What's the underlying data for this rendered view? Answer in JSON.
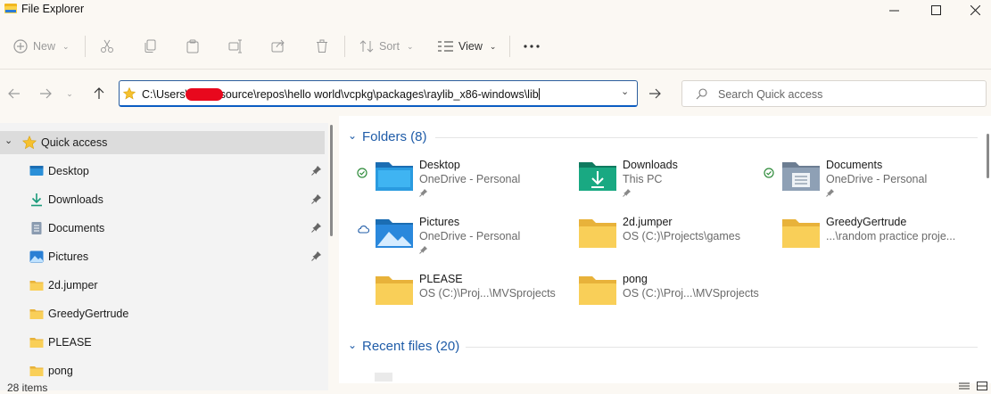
{
  "window": {
    "title": "File Explorer"
  },
  "toolbar": {
    "new_label": "New",
    "sort_label": "Sort",
    "view_label": "View"
  },
  "address": {
    "path_prefix": "C:\\Users\\",
    "path_suffix": "\\source\\repos\\hello world\\vcpkg\\packages\\raylib_x86-windows\\lib"
  },
  "search": {
    "placeholder": "Search Quick access"
  },
  "sidebar": {
    "items": [
      {
        "label": "Quick access",
        "icon": "star-icon"
      },
      {
        "label": "Desktop",
        "icon": "desktop-icon",
        "pinned": true
      },
      {
        "label": "Downloads",
        "icon": "download-icon",
        "pinned": true
      },
      {
        "label": "Documents",
        "icon": "document-icon",
        "pinned": true
      },
      {
        "label": "Pictures",
        "icon": "pictures-icon",
        "pinned": true
      },
      {
        "label": "2d.jumper",
        "icon": "folder-icon"
      },
      {
        "label": "GreedyGertrude",
        "icon": "folder-icon"
      },
      {
        "label": "PLEASE",
        "icon": "folder-icon"
      },
      {
        "label": "pong",
        "icon": "folder-icon"
      }
    ]
  },
  "main": {
    "folders_header": "Folders (8)",
    "recent_header": "Recent files (20)",
    "folders": [
      {
        "name": "Desktop",
        "location": "OneDrive - Personal",
        "status": "synced",
        "pinned": true
      },
      {
        "name": "Downloads",
        "location": "This PC",
        "pinned": true
      },
      {
        "name": "Documents",
        "location": "OneDrive - Personal",
        "status": "synced",
        "pinned": true
      },
      {
        "name": "Pictures",
        "location": "OneDrive - Personal",
        "status": "cloud",
        "pinned": true
      },
      {
        "name": "2d.jumper",
        "location": "OS (C:)\\Projects\\games"
      },
      {
        "name": "GreedyGertrude",
        "location": "...\\random practice proje..."
      },
      {
        "name": "PLEASE",
        "location": "OS (C:)\\Proj...\\MVSprojects"
      },
      {
        "name": "pong",
        "location": "OS (C:)\\Proj...\\MVSprojects"
      }
    ]
  },
  "status": {
    "items_count": "28 items"
  },
  "colors": {
    "accent": "#1f5ca8",
    "folder": "#f7c948",
    "address_border": "#0b5cc2"
  }
}
